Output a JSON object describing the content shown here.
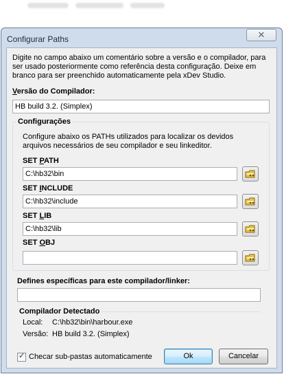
{
  "dialog": {
    "title": "Configurar Paths",
    "close_glyph": "✕",
    "intro": "Digite no campo abaixo um comentário sobre a versão e o compilador, para ser usado posteriormente como referência desta configuração. Deixe em branco para ser preenchido automaticamente pela xDev Studio.",
    "version_label_prefix": "V",
    "version_label_rest": "ersão do Compilador:",
    "version_value": "HB build 3.2. (Simplex)"
  },
  "config": {
    "title": "Configurações",
    "description": "Configure abaixo os PATHs utilizados para localizar os devidos arquivos necessários de seu compilador e seu linkeditor.",
    "fields": [
      {
        "label_pre": "SET ",
        "label_key": "P",
        "label_post": "ATH",
        "value": "C:\\hb32\\bin"
      },
      {
        "label_pre": "SET ",
        "label_key": "I",
        "label_post": "NCLUDE",
        "value": "C:\\hb32\\include"
      },
      {
        "label_pre": "SET ",
        "label_key": "L",
        "label_post": "IB",
        "value": "C:\\hb32\\lib"
      },
      {
        "label_pre": "SET ",
        "label_key": "O",
        "label_post": "BJ",
        "value": ""
      }
    ],
    "browse_icon": "folder-browse-icon"
  },
  "defines": {
    "label": "Defines específicas para este compilador/linker:",
    "value": ""
  },
  "detected": {
    "title": "Compilador Detectado",
    "local_label": "Local:",
    "local_value": "C:\\hb32\\bin\\harbour.exe",
    "version_label": "Versão:",
    "version_value": "HB build 3.2. (Simplex)"
  },
  "footer": {
    "checkbox_label": "Checar sub-pastas automaticamente",
    "checkbox_checked": true,
    "ok_label": "Ok",
    "cancel_label": "Cancelar"
  },
  "colors": {
    "frame": "#cfdcec",
    "client": "#f0f0f0",
    "default_button": "#3c7fb1"
  }
}
